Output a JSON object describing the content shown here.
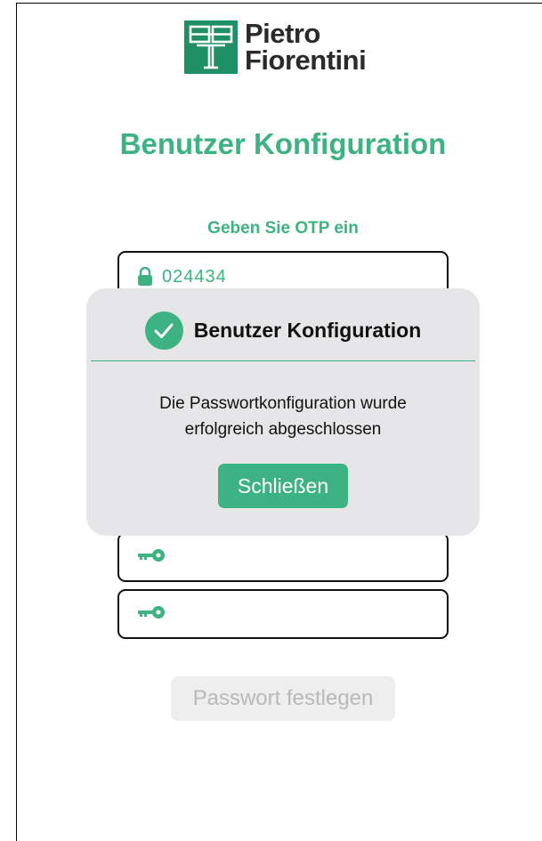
{
  "brand": {
    "line1": "Pietro",
    "line2": "Fiorentini",
    "color": "#1f8f66"
  },
  "page": {
    "title": "Benutzer Konfiguration",
    "otp_label": "Geben Sie OTP ein",
    "otp_value": "024434",
    "submit_label": "Passwort festlegen"
  },
  "dialog": {
    "title": "Benutzer Konfiguration",
    "message_line1": "Die Passwortkonfiguration wurde",
    "message_line2": "erfolgreich abgeschlossen",
    "close_label": "Schließen"
  },
  "colors": {
    "accent": "#3db283",
    "dialog_bg": "#e6e6e8",
    "disabled_text": "#b9b9bc"
  },
  "icons": {
    "otp": "lock-icon",
    "password": "key-icon",
    "confirm_password": "key-icon",
    "dialog": "checkmark-icon"
  }
}
